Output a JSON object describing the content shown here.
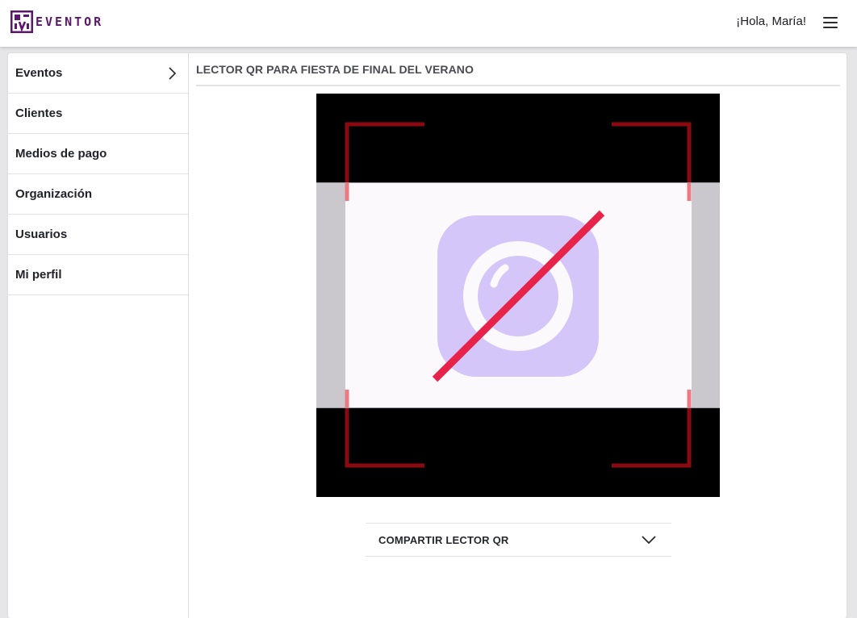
{
  "app": {
    "brand": "EVENTOR",
    "brand_color": "#5e1670",
    "greeting": "¡Hola, María!"
  },
  "sidebar": {
    "items": [
      {
        "label": "Eventos",
        "has_chevron": true
      },
      {
        "label": "Clientes"
      },
      {
        "label": "Medios de pago"
      },
      {
        "label": "Organización"
      },
      {
        "label": "Usuarios"
      },
      {
        "label": "Mi perfil"
      }
    ]
  },
  "main": {
    "title": "LECTOR QR PARA FIESTA DE FINAL DEL VERANO",
    "scanner": {
      "state": "camera-off",
      "icon": "camera-off-icon",
      "frame_color": "#8b0a12",
      "slash_color": "#e8234a",
      "icon_color": "#d5c6fa"
    },
    "share": {
      "label": "COMPARTIR LECTOR QR",
      "icon": "chevron-down-icon"
    }
  }
}
